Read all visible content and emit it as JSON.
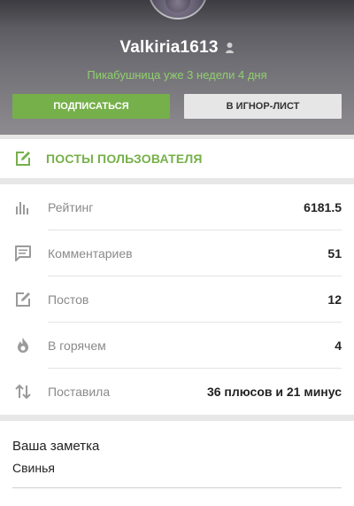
{
  "profile": {
    "username": "Valkiria1613",
    "gender_icon": "female-user-icon",
    "member_since": "Пикабушница уже 3 недели 4 дня",
    "subscribe_label": "ПОДПИСАТЬСЯ",
    "ignore_label": "В ИГНОР-ЛИСТ"
  },
  "posts_link": {
    "icon": "edit-icon",
    "label": "ПОСТЫ ПОЛЬЗОВАТЕЛЯ"
  },
  "stats": [
    {
      "icon": "bar-chart-icon",
      "label": "Рейтинг",
      "value": "6181.5"
    },
    {
      "icon": "comment-icon",
      "label": "Комментариев",
      "value": "51"
    },
    {
      "icon": "edit-icon",
      "label": "Постов",
      "value": "12"
    },
    {
      "icon": "flame-icon",
      "label": "В горячем",
      "value": "4"
    },
    {
      "icon": "up-down-arrows-icon",
      "label": "Поставила",
      "value": "36 плюсов и 21 минус"
    }
  ],
  "note": {
    "title": "Ваша заметка",
    "text": "Свинья"
  },
  "colors": {
    "accent": "#76b04a",
    "subtitle": "#8fd06b",
    "header_bg": "#6f6e74",
    "icon_gray": "#9a9a9a"
  }
}
